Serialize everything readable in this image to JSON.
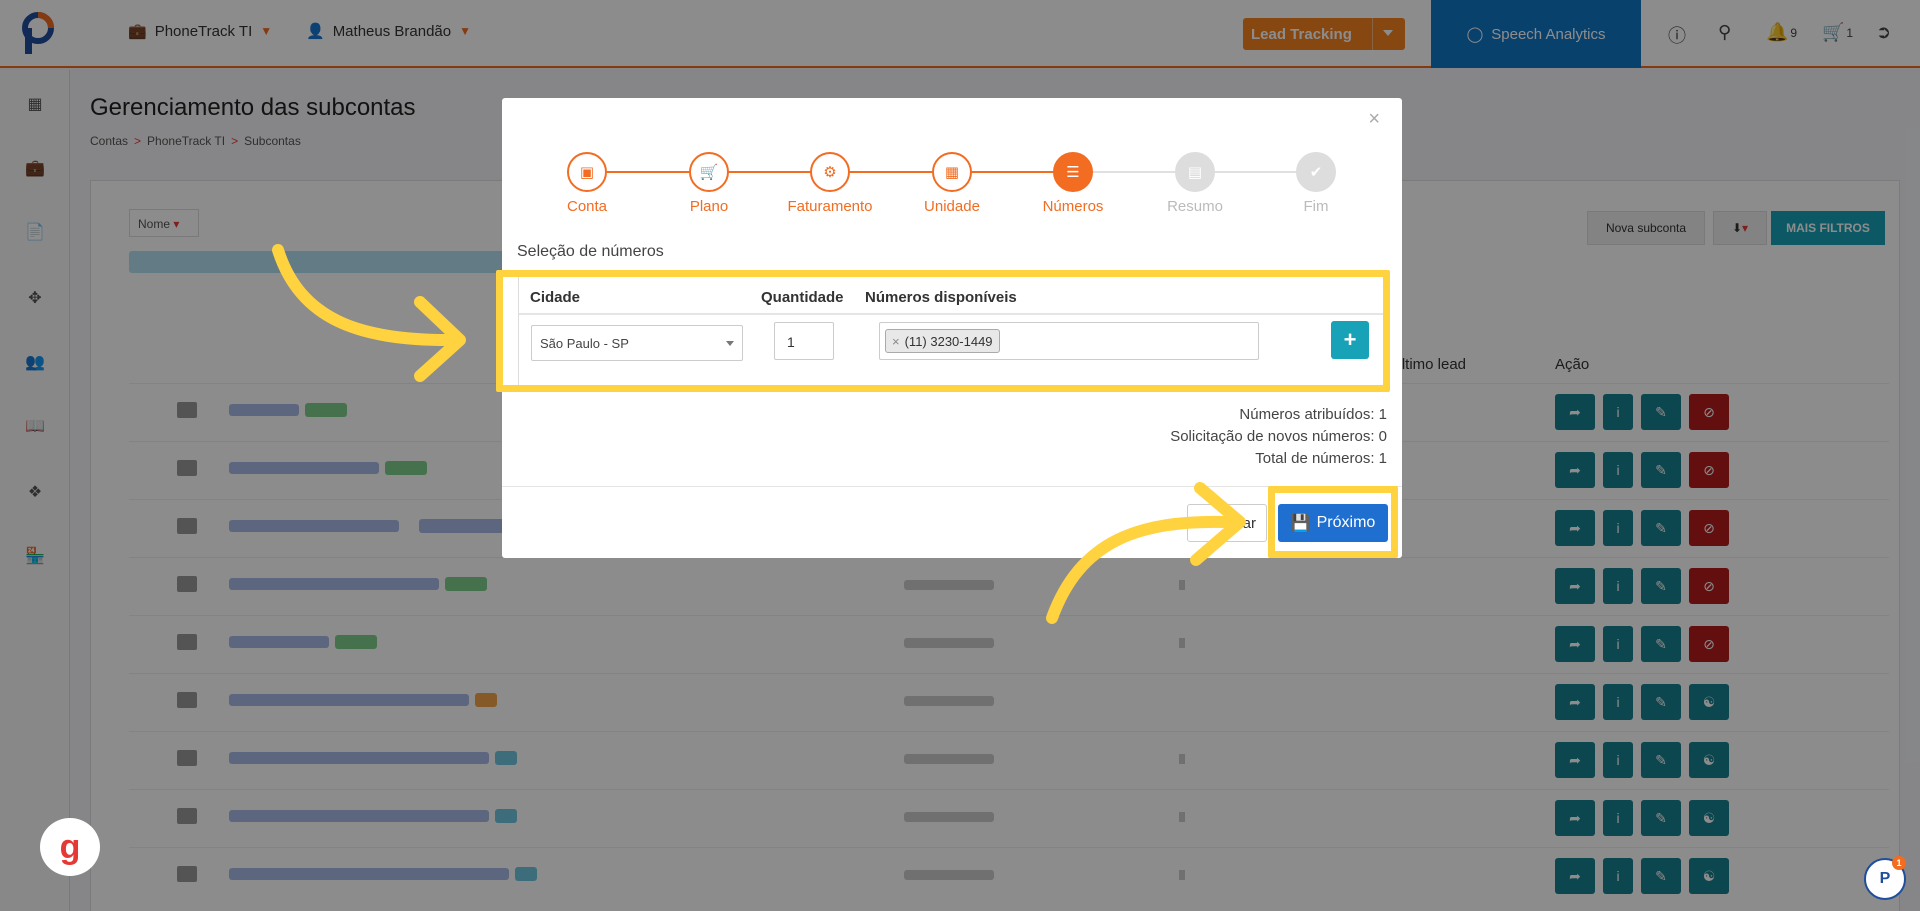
{
  "topbar": {
    "account": "PhoneTrack TI",
    "user": "Matheus Brandão",
    "lead_tracking": "Lead Tracking",
    "speech_analytics": "Speech Analytics",
    "notifications_count": "9",
    "cart_count": "1"
  },
  "page": {
    "title": "Gerenciamento das subcontas",
    "breadcrumb": [
      "Contas",
      "PhoneTrack TI",
      "Subcontas"
    ],
    "filter_label": "Nome",
    "btn_nova": "Nova subconta",
    "btn_mais_filtros": "MAIS FILTROS",
    "col_ultimo_lead": "Último lead",
    "col_acao": "Ação"
  },
  "modal": {
    "steps": [
      {
        "label": "Conta",
        "state": "done"
      },
      {
        "label": "Plano",
        "state": "done"
      },
      {
        "label": "Faturamento",
        "state": "done"
      },
      {
        "label": "Unidade",
        "state": "done"
      },
      {
        "label": "Números",
        "state": "active"
      },
      {
        "label": "Resumo",
        "state": "pending"
      },
      {
        "label": "Fim",
        "state": "pending"
      }
    ],
    "section_title": "Seleção de números",
    "col_cidade": "Cidade",
    "col_quantidade": "Quantidade",
    "col_numeros": "Números disponíveis",
    "city_value": "São Paulo - SP",
    "quantity_value": "1",
    "number_chip": "(11) 3230-1449",
    "summary": {
      "atribuidos": "Números atribuídos: 1",
      "solicitacao": "Solicitação de novos números: 0",
      "total": "Total de números: 1"
    },
    "btn_cancel": "ar",
    "btn_next": "Próximo"
  },
  "colors": {
    "brand_orange": "#f26c22",
    "brand_blue": "#1177c7",
    "teal": "#17a2b8",
    "danger": "#c62828",
    "highlight": "#ffd23f"
  }
}
